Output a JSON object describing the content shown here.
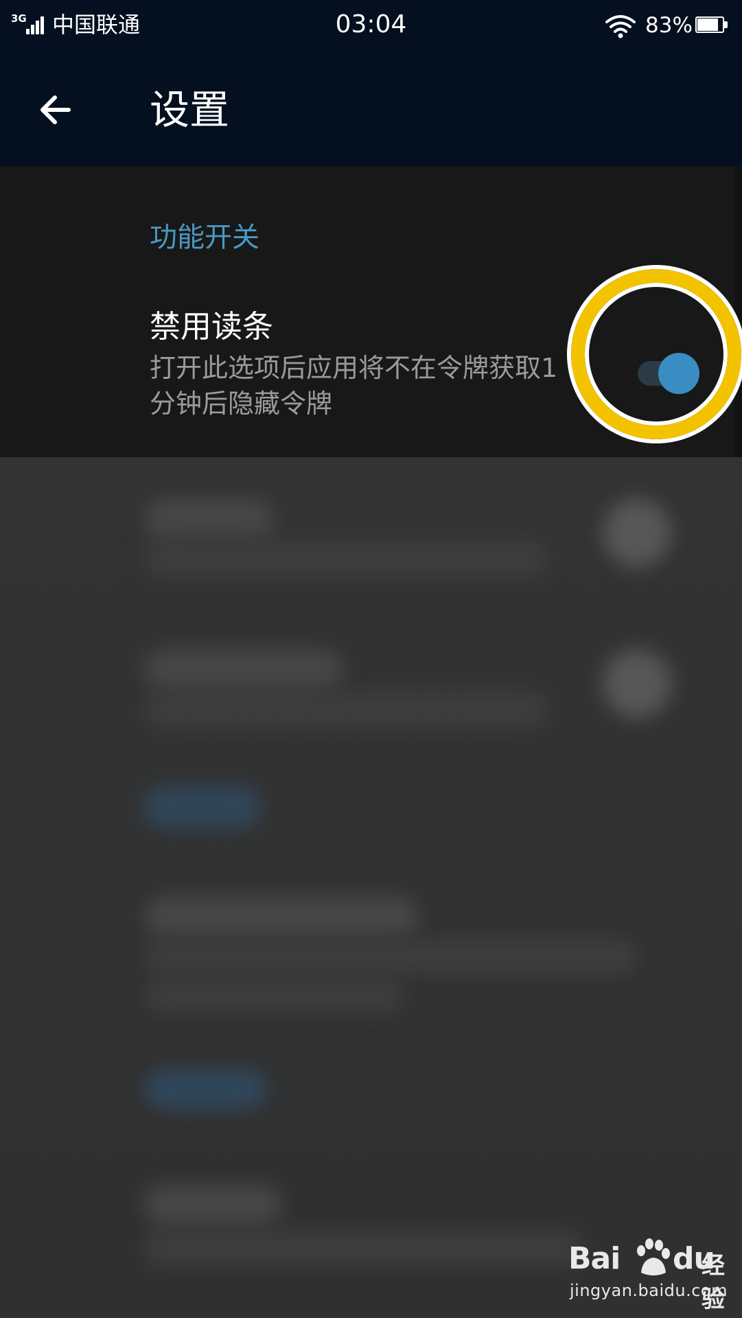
{
  "status_bar": {
    "network": "3G",
    "carrier": "中国联通",
    "time": "03:04",
    "battery_percent": "83%",
    "battery_level": 0.83,
    "icons": [
      "signal-icon",
      "wifi-icon",
      "battery-icon"
    ]
  },
  "app_bar": {
    "back_icon": "arrow-left-icon",
    "title": "设置"
  },
  "settings": {
    "section_header": "功能开关",
    "items": [
      {
        "title": "禁用读条",
        "description": "打开此选项后应用将不在令牌获取1分钟后隐藏令牌",
        "enabled": true
      }
    ]
  },
  "watermark": {
    "brand_left": "Bai",
    "brand_right": "du",
    "brand_cn": "经验",
    "url": "jingyan.baidu.com"
  },
  "colors": {
    "app_bar_bg": "#04101f",
    "accent": "#3a8dc2",
    "section_header": "#4a98c3",
    "highlight_ring": "#f3c300"
  }
}
